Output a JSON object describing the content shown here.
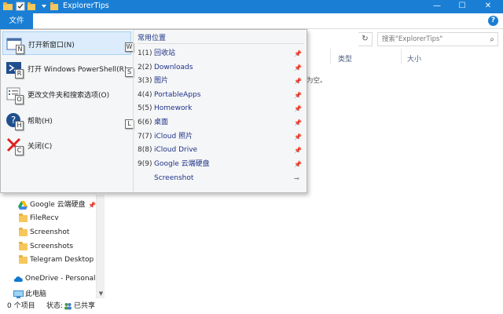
{
  "window": {
    "title": "ExplorerTips",
    "minimize": "—",
    "maximize": "☐",
    "close": "✕"
  },
  "ribbon": {
    "file_tab": "文件",
    "help": "?"
  },
  "address": {
    "refresh": "↻",
    "search_placeholder": "搜索\"ExplorerTips\"",
    "search_icon": "⌕"
  },
  "columns": {
    "type": "类型",
    "size": "大小"
  },
  "content": {
    "empty_message": "为空。"
  },
  "file_menu": {
    "items": [
      {
        "label": "打开新窗口(N)",
        "keytip": "N",
        "icon": "new-window-icon"
      },
      {
        "label": "打开 Windows PowerShell(R)",
        "keytip": "R",
        "icon": "powershell-icon"
      },
      {
        "label": "更改文件夹和搜索选项(O)",
        "keytip": "O",
        "icon": "folder-options-icon"
      },
      {
        "label": "帮助(H)",
        "keytip": "H",
        "icon": "help-icon"
      },
      {
        "label": "关闭(C)",
        "keytip": "C",
        "icon": "close-x-icon"
      }
    ],
    "extra_keytips": {
      "w": "W",
      "s": "S",
      "l": "L"
    },
    "frequent_title": "常用位置",
    "frequent": [
      {
        "num": "1(1)",
        "label": "回收站",
        "pin": "📌"
      },
      {
        "num": "2(2)",
        "label": "Downloads",
        "pin": "📌"
      },
      {
        "num": "3(3)",
        "label": "图片",
        "pin": "📌"
      },
      {
        "num": "4(4)",
        "label": "PortableApps",
        "pin": "📌"
      },
      {
        "num": "5(5)",
        "label": "Homework",
        "pin": "📌"
      },
      {
        "num": "6(6)",
        "label": "桌面",
        "pin": "📌"
      },
      {
        "num": "7(7)",
        "label": "iCloud 照片",
        "pin": "📌"
      },
      {
        "num": "8(8)",
        "label": "iCloud Drive",
        "pin": "📌"
      },
      {
        "num": "9(9)",
        "label": "Google 云端硬盘",
        "pin": "📌"
      },
      {
        "num": "",
        "label": "Screenshot",
        "pin": "⊸"
      }
    ]
  },
  "nav": {
    "items": [
      {
        "label": "Google 云端硬盘",
        "icon": "google-drive-icon",
        "pin": "📌"
      },
      {
        "label": "FileRecv",
        "icon": "folder-icon"
      },
      {
        "label": "Screenshot",
        "icon": "folder-icon"
      },
      {
        "label": "Screenshots",
        "icon": "folder-icon"
      },
      {
        "label": "Telegram Desktop",
        "icon": "folder-icon"
      },
      {
        "label": "OneDrive - Personal",
        "icon": "onedrive-icon"
      },
      {
        "label": "此电脑",
        "icon": "this-pc-icon"
      }
    ]
  },
  "status": {
    "count": "0 个项目",
    "state_label": "状态:",
    "shared": "已共享"
  },
  "colors": {
    "accent": "#1a7fd4",
    "link": "#1e3287",
    "hover": "#dcecfc"
  }
}
